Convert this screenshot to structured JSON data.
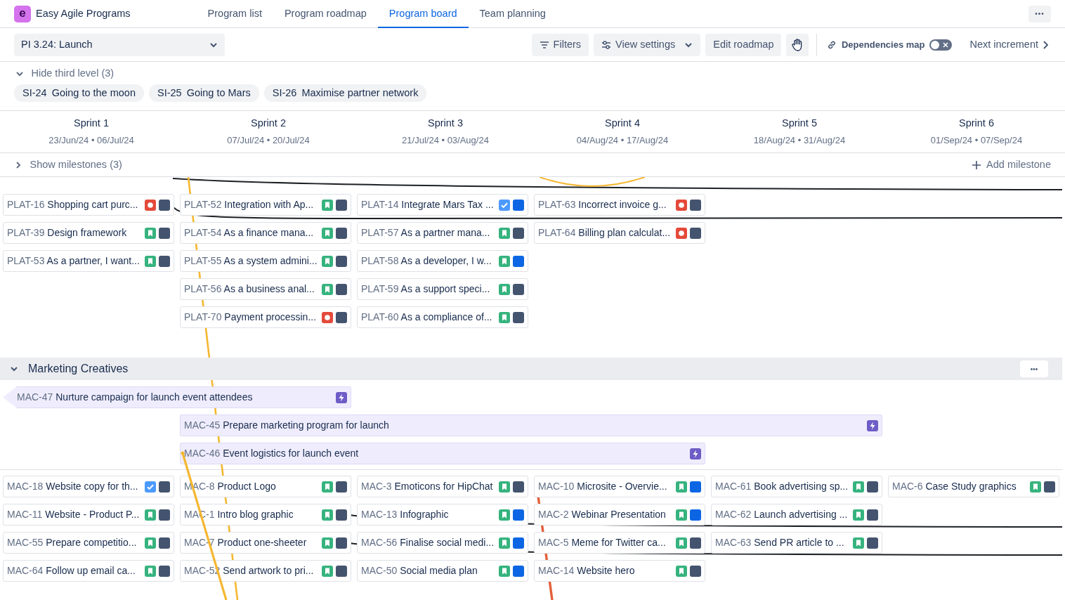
{
  "app": {
    "logo_letter": "e",
    "name": "Easy Agile Programs"
  },
  "nav": [
    {
      "label": "Program list",
      "selected": false
    },
    {
      "label": "Program roadmap",
      "selected": false
    },
    {
      "label": "Program board",
      "selected": true
    },
    {
      "label": "Team planning",
      "selected": false
    }
  ],
  "more_button": "•••",
  "toolbar": {
    "increment": "PI 3.24: Launch",
    "filters": "Filters",
    "view_settings": "View settings",
    "edit_roadmap": "Edit roadmap",
    "dependencies_label": "Dependencies map",
    "dependencies_on": false,
    "next": "Next increment"
  },
  "third_level": {
    "label": "Hide third level (3)",
    "expanded": true,
    "chips": [
      {
        "key": "SI-24",
        "title": "Going to the moon"
      },
      {
        "key": "SI-25",
        "title": "Going to Mars"
      },
      {
        "key": "SI-26",
        "title": "Maximise partner network"
      }
    ]
  },
  "sprints": [
    {
      "name": "Sprint 1",
      "dates": "23/Jun/24 • 06/Jul/24"
    },
    {
      "name": "Sprint 2",
      "dates": "07/Jul/24 • 20/Jul/24"
    },
    {
      "name": "Sprint 3",
      "dates": "21/Jul/24 • 03/Aug/24"
    },
    {
      "name": "Sprint 4",
      "dates": "04/Aug/24 • 17/Aug/24"
    },
    {
      "name": "Sprint 5",
      "dates": "18/Aug/24 • 31/Aug/24"
    },
    {
      "name": "Sprint 6",
      "dates": "01/Sep/24 • 07/Sep/24"
    }
  ],
  "milestones": {
    "label": "Show milestones (3)",
    "expanded": false,
    "add": "Add milestone"
  },
  "platform_team": {
    "columns": [
      [
        {
          "key": "PLAT-16",
          "title": "Shopping cart purc...",
          "kind": "bug",
          "color": "#44546f"
        },
        {
          "key": "PLAT-39",
          "title": "Design framework",
          "kind": "story",
          "color": "#44546f"
        },
        {
          "key": "PLAT-53",
          "title": "As a partner, I want...",
          "kind": "story",
          "color": "#44546f"
        }
      ],
      [
        {
          "key": "PLAT-52",
          "title": "Integration with Ap...",
          "kind": "story",
          "color": "#44546f"
        },
        {
          "key": "PLAT-54",
          "title": "As a finance mana...",
          "kind": "story",
          "color": "#44546f"
        },
        {
          "key": "PLAT-55",
          "title": "As a system admini...",
          "kind": "story",
          "color": "#44546f"
        },
        {
          "key": "PLAT-56",
          "title": "As a business anal...",
          "kind": "story",
          "color": "#44546f"
        },
        {
          "key": "PLAT-70",
          "title": "Payment processin...",
          "kind": "bug",
          "color": "#44546f"
        }
      ],
      [
        {
          "key": "PLAT-14",
          "title": "Integrate Mars Tax ...",
          "kind": "task",
          "color": "#0c66e4"
        },
        {
          "key": "PLAT-57",
          "title": "As a partner mana...",
          "kind": "story",
          "color": "#44546f"
        },
        {
          "key": "PLAT-58",
          "title": "As a developer, I w...",
          "kind": "story",
          "color": "#0c66e4"
        },
        {
          "key": "PLAT-59",
          "title": "As a support speci...",
          "kind": "story",
          "color": "#44546f"
        },
        {
          "key": "PLAT-60",
          "title": "As a compliance of...",
          "kind": "story",
          "color": "#44546f"
        }
      ],
      [
        {
          "key": "PLAT-63",
          "title": "Incorrect invoice g...",
          "kind": "bug",
          "color": "#44546f"
        },
        {
          "key": "PLAT-64",
          "title": "Billing plan calculat...",
          "kind": "bug",
          "color": "#44546f"
        }
      ]
    ]
  },
  "marketing_team": {
    "name": "Marketing Creatives",
    "expanded": true,
    "menu": "•••",
    "features": [
      {
        "key": "MAC-47",
        "title": "Nurture campaign for launch event attendees",
        "starts_before": true,
        "in_sprints": [
          true,
          true,
          false,
          false,
          false,
          false
        ]
      },
      {
        "key": "MAC-45",
        "title": "Prepare marketing program for launch",
        "starts_before": false,
        "in_sprints": [
          false,
          true,
          true,
          true,
          true,
          false
        ]
      },
      {
        "key": "MAC-46",
        "title": "Event logistics for launch event",
        "starts_before": false,
        "in_sprints": [
          false,
          true,
          true,
          true,
          false,
          false
        ]
      }
    ],
    "columns": [
      [
        {
          "key": "MAC-18",
          "title": "Website copy for th...",
          "kind": "task",
          "color": "#44546f"
        },
        {
          "key": "MAC-11",
          "title": "Website - Product P...",
          "kind": "story",
          "color": "#44546f"
        },
        {
          "key": "MAC-55",
          "title": "Prepare competitio...",
          "kind": "story",
          "color": "#44546f"
        },
        {
          "key": "MAC-64",
          "title": "Follow up email ca...",
          "kind": "story",
          "color": "#44546f"
        }
      ],
      [
        {
          "key": "MAC-8",
          "title": "Product Logo",
          "kind": "story",
          "color": "#44546f"
        },
        {
          "key": "MAC-1",
          "title": "Intro blog graphic",
          "kind": "story",
          "color": "#44546f"
        },
        {
          "key": "MAC-7",
          "title": "Product one-sheeter",
          "kind": "story",
          "color": "#44546f"
        },
        {
          "key": "MAC-52",
          "title": "Send artwork to pri...",
          "kind": "story",
          "color": "#44546f"
        }
      ],
      [
        {
          "key": "MAC-3",
          "title": "Emoticons for HipChat",
          "kind": "story",
          "color": "#44546f"
        },
        {
          "key": "MAC-13",
          "title": "Infographic",
          "kind": "story",
          "color": "#0c66e4"
        },
        {
          "key": "MAC-56",
          "title": "Finalise social medi...",
          "kind": "story",
          "color": "#0c66e4"
        },
        {
          "key": "MAC-50",
          "title": "Social media plan",
          "kind": "story",
          "color": "#0c66e4"
        }
      ],
      [
        {
          "key": "MAC-10",
          "title": "Microsite - Overvie...",
          "kind": "story",
          "color": "#0c66e4"
        },
        {
          "key": "MAC-2",
          "title": "Webinar Presentation",
          "kind": "story",
          "color": "#0c66e4"
        },
        {
          "key": "MAC-5",
          "title": "Meme for Twitter ca...",
          "kind": "story",
          "color": "#44546f"
        },
        {
          "key": "MAC-14",
          "title": "Website hero",
          "kind": "story",
          "color": "#44546f"
        }
      ],
      [
        {
          "key": "MAC-61",
          "title": "Book advertising sp...",
          "kind": "story",
          "color": "#44546f"
        },
        {
          "key": "MAC-62",
          "title": "Launch advertising ...",
          "kind": "story",
          "color": "#44546f"
        },
        {
          "key": "MAC-63",
          "title": "Send PR article to ...",
          "kind": "story",
          "color": "#44546f"
        }
      ],
      [
        {
          "key": "MAC-6",
          "title": "Case Study graphics",
          "kind": "story",
          "color": "#44546f"
        }
      ]
    ]
  },
  "dependencies": [
    {
      "color": "#1d2125"
    },
    {
      "color": "#1d2125"
    },
    {
      "color": "#f5b731"
    },
    {
      "color": "#f5b731"
    },
    {
      "color": "#f5b731"
    },
    {
      "color": "#e2603a"
    },
    {
      "color": "#1d2125"
    },
    {
      "color": "#1d2125"
    }
  ]
}
